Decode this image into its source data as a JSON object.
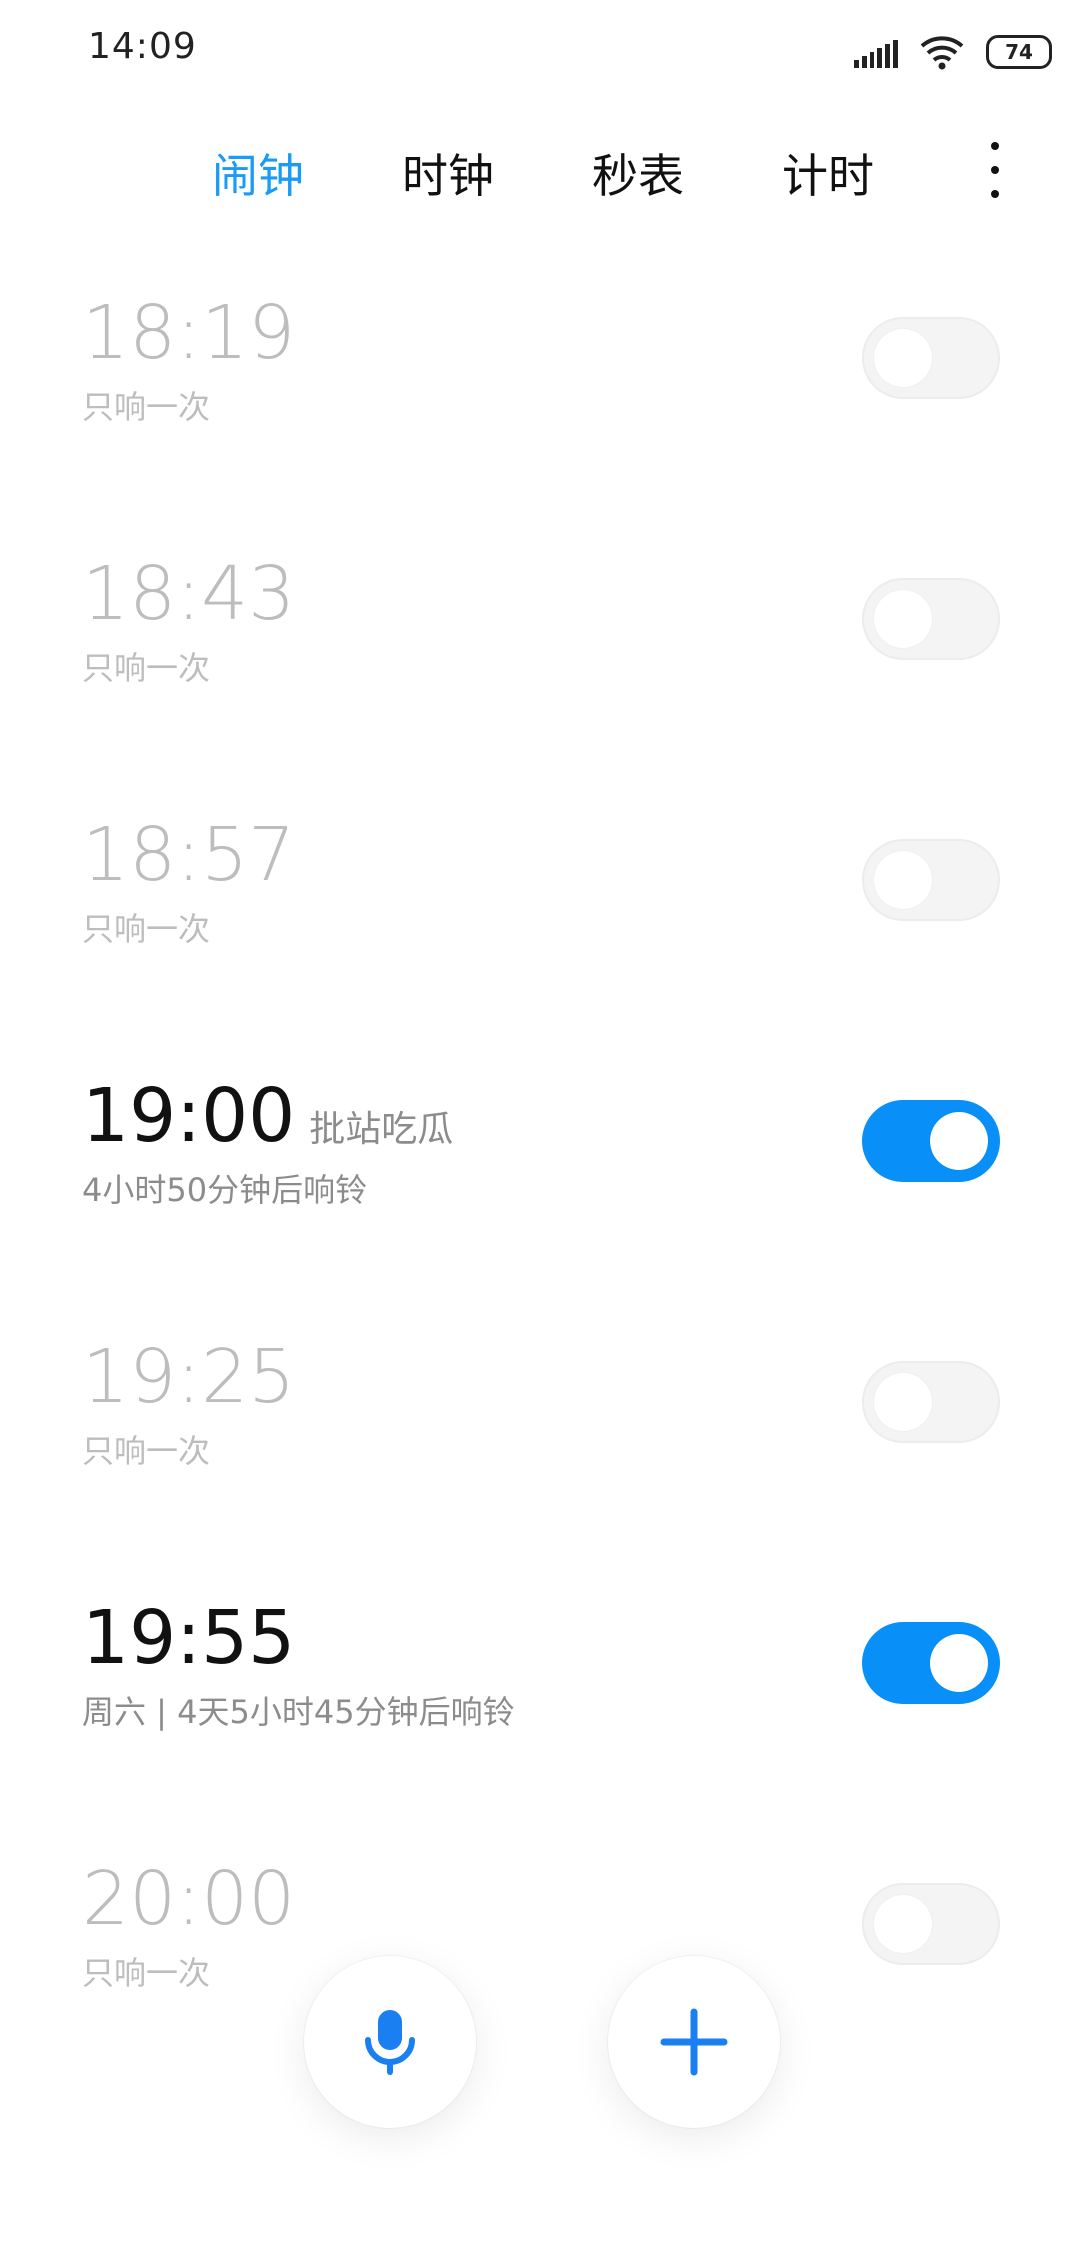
{
  "status_bar": {
    "time": "14:09",
    "battery": "74"
  },
  "tabs": {
    "alarm": "闹钟",
    "clock": "时钟",
    "stopwatch": "秒表",
    "timer": "计时"
  },
  "alarms": [
    {
      "time": "18:19",
      "label": "",
      "subtitle": "只响一次",
      "enabled": false
    },
    {
      "time": "18:43",
      "label": "",
      "subtitle": "只响一次",
      "enabled": false
    },
    {
      "time": "18:57",
      "label": "",
      "subtitle": "只响一次",
      "enabled": false
    },
    {
      "time": "19:00",
      "label": "批站吃瓜",
      "subtitle": "4小时50分钟后响铃",
      "enabled": true
    },
    {
      "time": "19:25",
      "label": "",
      "subtitle": "只响一次",
      "enabled": false
    },
    {
      "time": "19:55",
      "label": "",
      "subtitle": "周六 | 4天5小时45分钟后响铃",
      "enabled": true
    },
    {
      "time": "20:00",
      "label": "",
      "subtitle": "只响一次",
      "enabled": false
    }
  ],
  "colors": {
    "accent": "#1a9bf7",
    "toggle_on": "#0890f8",
    "fab_icon": "#1a7ff0"
  },
  "icons": {
    "mic_button": "microphone-icon",
    "add_button": "plus-icon",
    "more": "more-vertical-icon"
  }
}
